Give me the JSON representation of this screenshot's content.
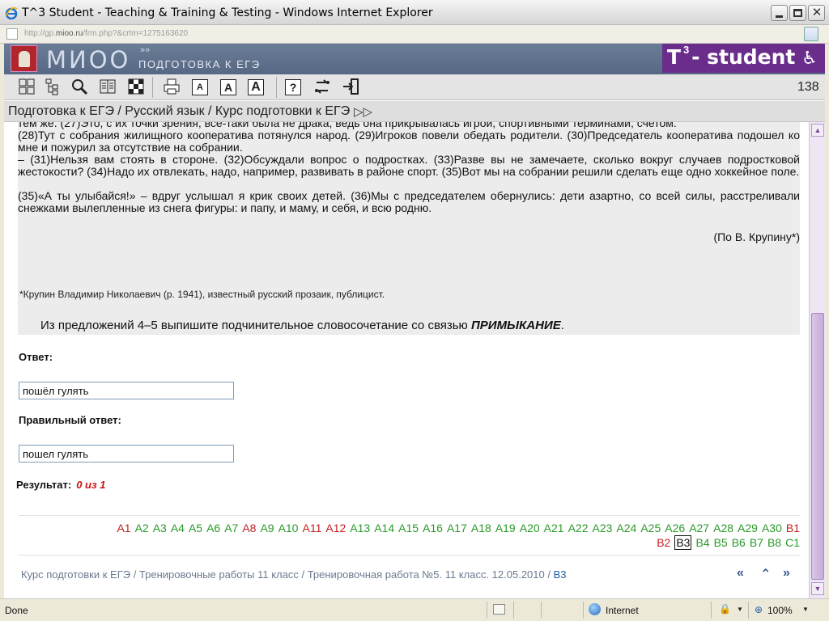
{
  "window": {
    "title": "T^3 Student - Teaching & Training & Testing - Windows Internet Explorer",
    "address_prefix": "http://gp.",
    "address_host": "mioo.ru",
    "address_suffix": "/frm.php?&crtm=1275163620"
  },
  "banner": {
    "logo_text": "МИОО",
    "logo_chevrons": "»»",
    "subtitle": "ПОДГОТОВКА К ЕГЭ",
    "brand": "T",
    "brand_sup": "3",
    "brand_rest": "- student"
  },
  "toolbar": {
    "icons": [
      "grid-icon",
      "tree-icon",
      "magnifier-icon",
      "book-icon",
      "checker-icon",
      "print-icon",
      "font-small-icon",
      "font-medium-icon",
      "font-large-icon",
      "help-icon",
      "swap-icon",
      "exit-icon"
    ],
    "font_small": "A",
    "font_medium": "A",
    "font_large": "A",
    "help": "?",
    "counter": "138"
  },
  "breadcrumb": {
    "text": "Подготовка к ЕГЭ / Русский язык /  Курс подготовки к ЕГЭ",
    "forward": "▷▷"
  },
  "text": {
    "cut_line": "тем же. (27)Это, с их точки зрения, все-таки была не драка, ведь она прикрывалась игрой, спортивными терминами, счетом.",
    "p28": "     (28)Тут с собрания жилищного кооператива потянулся народ. (29)Игроков повели обедать родители. (30)Председатель кооператива подошел ко мне и пожурил за отсутствие на собрании.",
    "p31": "     – (31)Нельзя вам стоять в стороне. (32)Обсуждали вопрос о подростках. (33)Разве вы не замечаете, сколько вокруг случаев подростковой жестокости? (34)Надо их отвлекать, надо, например, развивать в районе спорт. (35)Вот мы на собрании решили сделать еще одно хоккейное поле.",
    "p35": "     (35)«А ты улыбайся!» – вдруг услышал я крик своих детей. (36)Мы с председателем обернулись: дети азартно, со всей силы, расстреливали снежками вылепленные из снега фигуры: и папу, и маму, и себя, и всю родню.",
    "author": "(По В. Крупину*)",
    "footnote": "*Крупин Владимир Николаевич (р. 1941), известный русский прозаик, публицист.",
    "question_pre": "Из предложений 4–5 выпишите подчинительное словосочетание со связью ",
    "question_bold": "ПРИМЫКАНИЕ",
    "question_post": "."
  },
  "answer": {
    "label": "Ответ:",
    "value": "пошёл гулять",
    "correct_label": "Правильный ответ:",
    "correct_value": "пошел гулять",
    "result_label": "Результат:",
    "result_value": "0 из 1"
  },
  "nav": {
    "row1": [
      {
        "t": "A1",
        "s": "r"
      },
      {
        "t": "A2",
        "s": "g"
      },
      {
        "t": "A3",
        "s": "g"
      },
      {
        "t": "A4",
        "s": "g"
      },
      {
        "t": "A5",
        "s": "g"
      },
      {
        "t": "A6",
        "s": "g"
      },
      {
        "t": "A7",
        "s": "g"
      },
      {
        "t": "A8",
        "s": "r"
      },
      {
        "t": "A9",
        "s": "g"
      },
      {
        "t": "A10",
        "s": "g"
      },
      {
        "t": "A11",
        "s": "r"
      },
      {
        "t": "A12",
        "s": "r"
      },
      {
        "t": "A13",
        "s": "g"
      },
      {
        "t": "A14",
        "s": "g"
      },
      {
        "t": "A15",
        "s": "g"
      },
      {
        "t": "A16",
        "s": "g"
      },
      {
        "t": "A17",
        "s": "g"
      },
      {
        "t": "A18",
        "s": "g"
      },
      {
        "t": "A19",
        "s": "g"
      },
      {
        "t": "A20",
        "s": "g"
      },
      {
        "t": "A21",
        "s": "g"
      },
      {
        "t": "A22",
        "s": "g"
      },
      {
        "t": "A23",
        "s": "g"
      },
      {
        "t": "A24",
        "s": "g"
      },
      {
        "t": "A25",
        "s": "g"
      },
      {
        "t": "A26",
        "s": "g"
      },
      {
        "t": "A27",
        "s": "g"
      },
      {
        "t": "A28",
        "s": "g"
      },
      {
        "t": "A29",
        "s": "g"
      },
      {
        "t": "A30",
        "s": "g"
      },
      {
        "t": "B1",
        "s": "r"
      }
    ],
    "row2": [
      {
        "t": "B2",
        "s": "r"
      },
      {
        "t": "B3",
        "s": "cur"
      },
      {
        "t": "B4",
        "s": "g"
      },
      {
        "t": "B5",
        "s": "g"
      },
      {
        "t": "B6",
        "s": "g"
      },
      {
        "t": "B7",
        "s": "g"
      },
      {
        "t": "B8",
        "s": "g"
      },
      {
        "t": "C1",
        "s": "g"
      }
    ]
  },
  "footer": {
    "crumb": "Курс подготовки к ЕГЭ / Тренировочные работы 11 класс / Тренировочная работа №5. 11 класс. 12.05.2010 / ",
    "current": "B3",
    "first": "«",
    "up": "⌃",
    "next": "»"
  },
  "status": {
    "left": "Done",
    "zone": "Internet",
    "zoom": "100%"
  },
  "colors": {
    "correct": "#2a9a2a",
    "wrong": "#c62020",
    "banner": "#566884",
    "brand": "#6b2d8c"
  }
}
